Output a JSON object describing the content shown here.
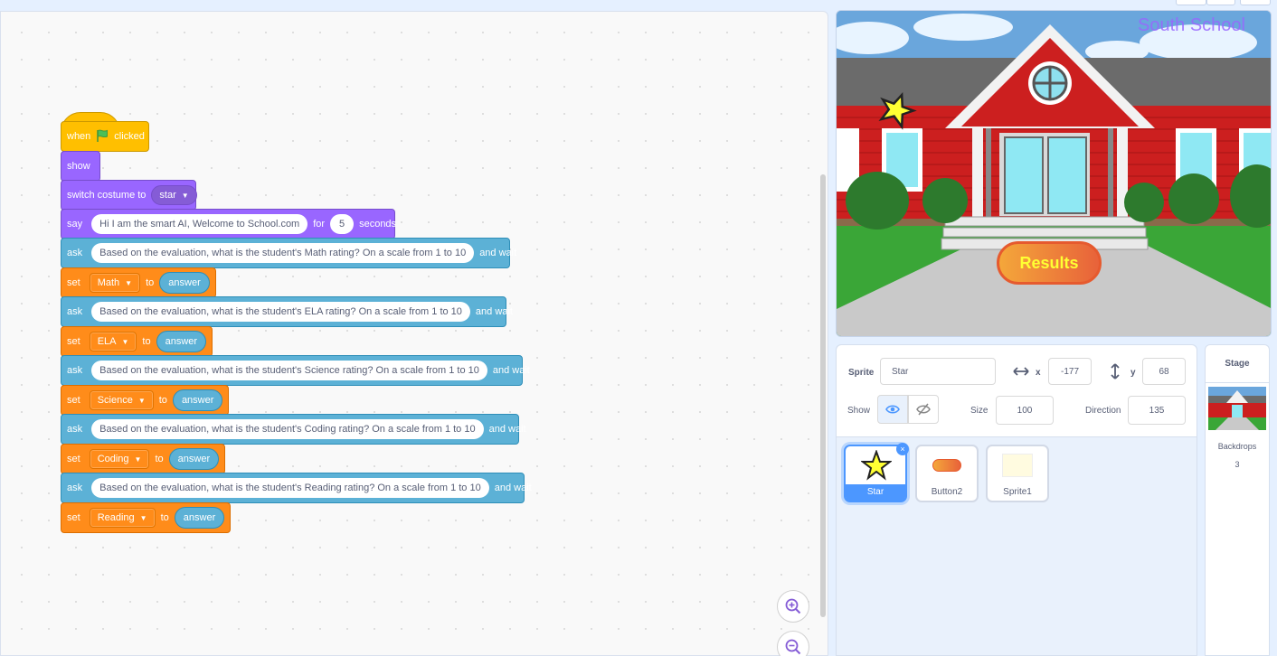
{
  "script": {
    "hat": {
      "when": "when",
      "clicked": "clicked"
    },
    "show": "show",
    "switch_costume": {
      "label": "switch costume to",
      "value": "star"
    },
    "say": {
      "label": "say",
      "message": "Hi I am the smart AI, Welcome to School.com",
      "for": "for",
      "secs": "5",
      "seconds": "seconds"
    },
    "rows": [
      {
        "ask": "ask",
        "question": "Based on the evaluation, what is the student's Math rating? On a scale from 1 to 10",
        "and_wait": "and wait",
        "set": "set",
        "variable": "Math",
        "to": "to",
        "answer": "answer"
      },
      {
        "ask": "ask",
        "question": "Based on the evaluation, what is the student's ELA rating? On a scale from 1 to 10",
        "and_wait": "and wait",
        "set": "set",
        "variable": "ELA",
        "to": "to",
        "answer": "answer"
      },
      {
        "ask": "ask",
        "question": "Based on the evaluation, what is the student's Science rating? On a scale from 1 to 10",
        "and_wait": "and wait",
        "set": "set",
        "variable": "Science",
        "to": "to",
        "answer": "answer"
      },
      {
        "ask": "ask",
        "question": "Based on the evaluation, what is the student's Coding rating? On a scale from 1 to 10",
        "and_wait": "and wait",
        "set": "set",
        "variable": "Coding",
        "to": "to",
        "answer": "answer"
      },
      {
        "ask": "ask",
        "question": "Based on the evaluation, what is the student's Reading rating? On a scale from 1 to 10",
        "and_wait": "and wait",
        "set": "set",
        "variable": "Reading",
        "to": "to",
        "answer": "answer"
      }
    ]
  },
  "stage": {
    "title": "South School",
    "button_label": "Results"
  },
  "sprite_info": {
    "sprite_label": "Sprite",
    "sprite_name": "Star",
    "x_label": "x",
    "x_value": "-177",
    "y_label": "y",
    "y_value": "68",
    "show_label": "Show",
    "size_label": "Size",
    "size_value": "100",
    "direction_label": "Direction",
    "direction_value": "135"
  },
  "sprites": [
    {
      "name": "Star"
    },
    {
      "name": "Button2"
    },
    {
      "name": "Sprite1"
    }
  ],
  "stage_selector": {
    "header": "Stage",
    "backdrops_label": "Backdrops",
    "backdrops_count": "3"
  },
  "colors": {
    "events": "#ffbf00",
    "looks": "#9966ff",
    "sensing": "#5cb1d6",
    "variables": "#ff8c1a",
    "accent": "#4c97ff"
  }
}
